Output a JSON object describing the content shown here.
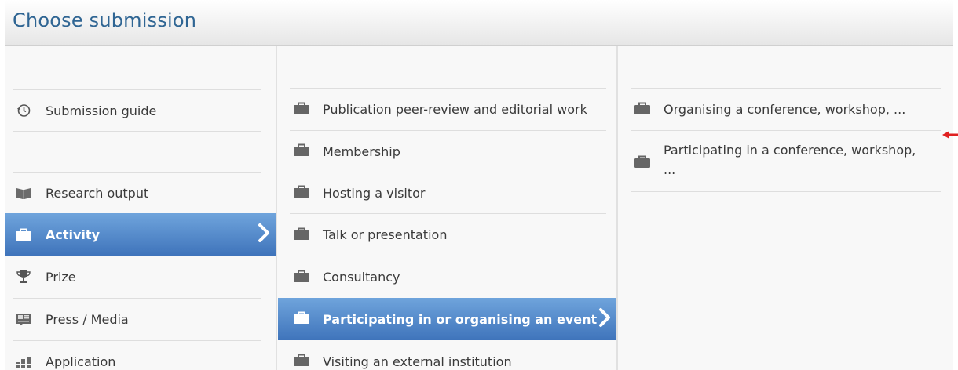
{
  "header": {
    "title": "Choose submission"
  },
  "column1": {
    "items": [
      {
        "label": "Submission guide",
        "icon": "history-clock-icon"
      },
      {
        "label": "Research output",
        "icon": "book-icon"
      },
      {
        "label": "Activity",
        "icon": "briefcase-icon",
        "selected": true
      },
      {
        "label": "Prize",
        "icon": "trophy-icon"
      },
      {
        "label": "Press / Media",
        "icon": "newspaper-icon"
      },
      {
        "label": "Application",
        "icon": "bar-chart-icon"
      }
    ]
  },
  "column2": {
    "items": [
      {
        "label": "Publication peer-review and editorial work",
        "icon": "briefcase-icon"
      },
      {
        "label": "Membership",
        "icon": "briefcase-icon"
      },
      {
        "label": "Hosting a visitor",
        "icon": "briefcase-icon"
      },
      {
        "label": "Talk or presentation",
        "icon": "briefcase-icon"
      },
      {
        "label": "Consultancy",
        "icon": "briefcase-icon"
      },
      {
        "label": "Participating in or organising an event",
        "icon": "briefcase-icon",
        "selected": true
      },
      {
        "label": "Visiting an external institution",
        "icon": "briefcase-icon"
      }
    ]
  },
  "column3": {
    "items": [
      {
        "label": "Organising a conference, workshop, ...",
        "icon": "briefcase-icon"
      },
      {
        "label": "Participating in a conference, workshop, ...",
        "icon": "briefcase-icon"
      }
    ]
  },
  "colors": {
    "selected_gradient_top": "#6fa4dc",
    "selected_gradient_bottom": "#3f74bb",
    "title": "#2f6593",
    "annotation_arrow": "#e02020"
  }
}
